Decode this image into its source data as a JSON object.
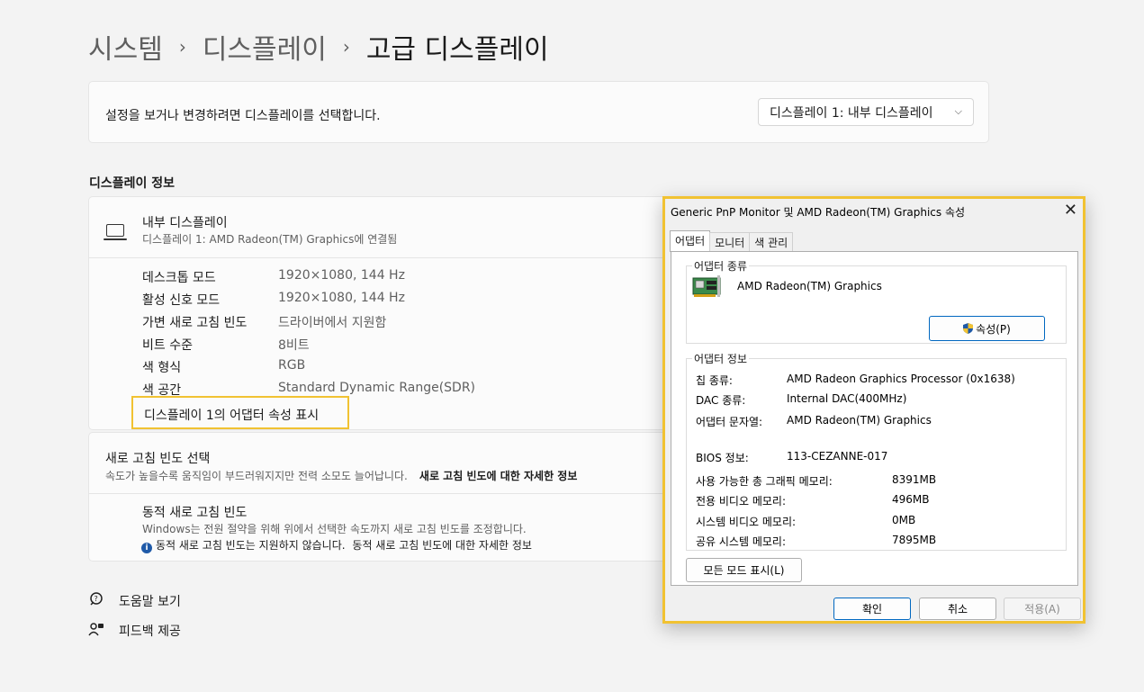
{
  "breadcrumb": {
    "items": [
      "시스템",
      "디스플레이"
    ],
    "current": "고급 디스플레이",
    "separator": "›"
  },
  "selector": {
    "prompt": "설정을 보거나 변경하려면 디스플레이를 선택합니다.",
    "selected": "디스플레이 1: 내부 디스플레이"
  },
  "display_info": {
    "section_title": "디스플레이 정보",
    "name": "내부 디스플레이",
    "subtitle": "디스플레이 1: AMD Radeon(TM) Graphics에 연결됨",
    "rows": [
      {
        "label": "데스크톱 모드",
        "value": "1920×1080, 144 Hz"
      },
      {
        "label": "활성 신호 모드",
        "value": "1920×1080, 144 Hz"
      },
      {
        "label": "가변 새로 고침 빈도",
        "value": "드라이버에서 지원함"
      },
      {
        "label": "비트 수준",
        "value": "8비트"
      },
      {
        "label": "색 형식",
        "value": "RGB"
      },
      {
        "label": "색 공간",
        "value": "Standard Dynamic Range(SDR)"
      }
    ],
    "adapter_link": "디스플레이 1의 어댑터 속성 표시"
  },
  "refresh": {
    "title": "새로 고침 빈도 선택",
    "desc": "속도가 높을수록 움직임이 부드러워지지만 전력 소모도 늘어납니다.",
    "link": "새로 고침 빈도에 대한 자세한 정보"
  },
  "dynamic": {
    "title": "동적 새로 고침 빈도",
    "desc": "Windows는 전원 절약을 위해 위에서 선택한 속도까지 새로 고침 빈도를 조정합니다.",
    "note": "동적 새로 고침 빈도는 지원하지 않습니다.",
    "link": "동적 새로 고침 빈도에 대한 자세한 정보"
  },
  "footer": {
    "help": "도움말 보기",
    "feedback": "피드백 제공"
  },
  "dialog": {
    "title": "Generic PnP Monitor 및 AMD Radeon(TM) Graphics 속성",
    "tabs": [
      "어댑터",
      "모니터",
      "색 관리"
    ],
    "adapter_type_title": "어댑터 종류",
    "adapter_name": "AMD Radeon(TM) Graphics",
    "properties_button": "속성(P)",
    "adapter_info_title": "어댑터 정보",
    "info": [
      {
        "label": "칩 종류:",
        "value": "AMD Radeon Graphics Processor (0x1638)"
      },
      {
        "label": "DAC 종류:",
        "value": "Internal DAC(400MHz)"
      },
      {
        "label": "어댑터 문자열:",
        "value": "AMD Radeon(TM) Graphics"
      },
      {
        "label": "BIOS 정보:",
        "value": "113-CEZANNE-017"
      }
    ],
    "memory": [
      {
        "label": "사용 가능한 총 그래픽 메모리:",
        "value": "8391MB"
      },
      {
        "label": "전용 비디오 메모리:",
        "value": "496MB"
      },
      {
        "label": "시스템 비디오 메모리:",
        "value": "0MB"
      },
      {
        "label": "공유 시스템 메모리:",
        "value": "7895MB"
      }
    ],
    "all_modes_button": "모든 모드 표시(L)",
    "ok": "확인",
    "cancel": "취소",
    "apply": "적용(A)"
  }
}
